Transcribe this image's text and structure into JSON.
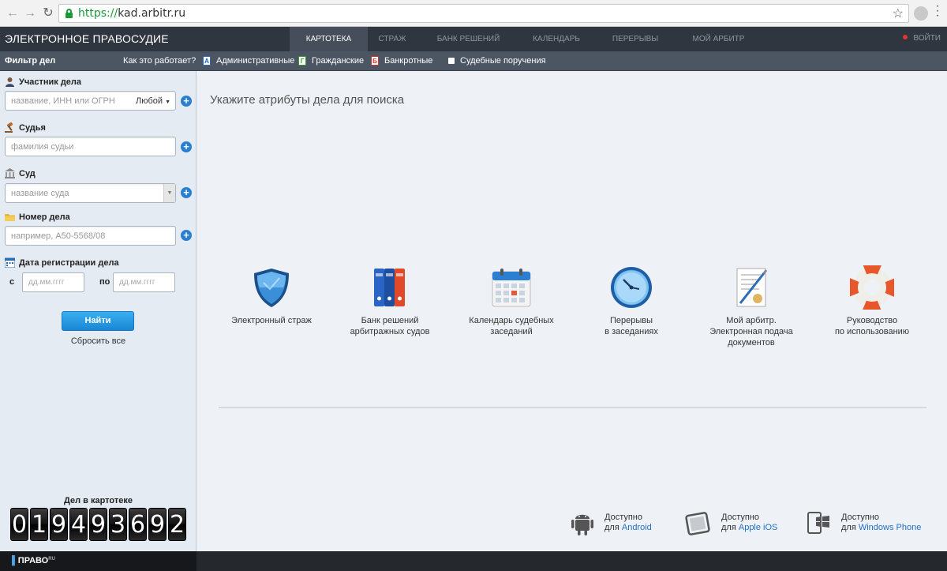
{
  "browser": {
    "url_scheme": "https://",
    "url_host": "kad.arbitr.ru"
  },
  "header": {
    "brand": "ЭЛЕКТРОННОЕ ПРАВОСУДИЕ",
    "tabs": [
      {
        "label": "КАРТОТЕКА",
        "active": true
      },
      {
        "label": "СТРАЖ",
        "active": false
      },
      {
        "label": "БАНК РЕШЕНИЙ",
        "active": false
      },
      {
        "label": "КАЛЕНДАРЬ",
        "active": false
      },
      {
        "label": "ПЕРЕРЫВЫ",
        "active": false
      },
      {
        "label": "МОЙ АРБИТР",
        "active": false
      }
    ],
    "login": "ВОЙТИ"
  },
  "filterbar": {
    "title": "Фильтр дел",
    "how_it_works": "Как это работает?",
    "types": [
      {
        "badge": "А",
        "label": "Административные"
      },
      {
        "badge": "Г",
        "label": "Гражданские"
      },
      {
        "badge": "Б",
        "label": "Банкротные"
      },
      {
        "badge": "",
        "label": "Судебные поручения"
      }
    ]
  },
  "sidebar": {
    "participant": {
      "label": "Участник дела",
      "placeholder": "название, ИНН или ОГРН",
      "role": "Любой"
    },
    "judge": {
      "label": "Судья",
      "placeholder": "фамилия судьи"
    },
    "court": {
      "label": "Суд",
      "placeholder": "название суда"
    },
    "case_number": {
      "label": "Номер дела",
      "placeholder": "например, А50-5568/08"
    },
    "reg_date": {
      "label": "Дата регистрации дела",
      "from_label": "с",
      "to_label": "по",
      "from_placeholder": "дд.мм.гггг",
      "to_placeholder": "дд.мм.гггг"
    },
    "find_button": "Найти",
    "reset_link": "Сбросить все",
    "counter_title": "Дел в картотеке",
    "counter_digits": [
      "0",
      "1",
      "9",
      "4",
      "9",
      "3",
      "6",
      "9",
      "2"
    ]
  },
  "main": {
    "title": "Укажите атрибуты дела для поиска",
    "services": [
      {
        "icon": "shield-icon",
        "label": "Электронный страж"
      },
      {
        "icon": "binders-icon",
        "label": "Банк решений\nарбитражных судов"
      },
      {
        "icon": "calendar-icon",
        "label": "Календарь судебных\nзаседаний"
      },
      {
        "icon": "clock-icon",
        "label": "Перерывы\nв заседаниях"
      },
      {
        "icon": "document-pen-icon",
        "label": "Мой арбитр.\nЭлектронная подача\nдокументов"
      },
      {
        "icon": "lifebuoy-icon",
        "label": "Руководство\nпо использованию"
      }
    ],
    "platforms": [
      {
        "icon": "android-icon",
        "line1": "Доступно",
        "prefix": "для ",
        "link": "Android"
      },
      {
        "icon": "ipad-icon",
        "line1": "Доступно",
        "prefix": "для ",
        "link": "Apple iOS"
      },
      {
        "icon": "windows-phone-icon",
        "line1": "Доступно",
        "prefix": "для ",
        "link": "Windows Phone"
      }
    ]
  },
  "footer": {
    "logo": "ПРАВО",
    "logo_sup": "RU"
  },
  "colors": {
    "nav_bg": "#2f3640",
    "filterbar_bg": "#4c5663",
    "accent_blue": "#2a7fd0",
    "sidebar_bg": "#e4ebf3"
  }
}
